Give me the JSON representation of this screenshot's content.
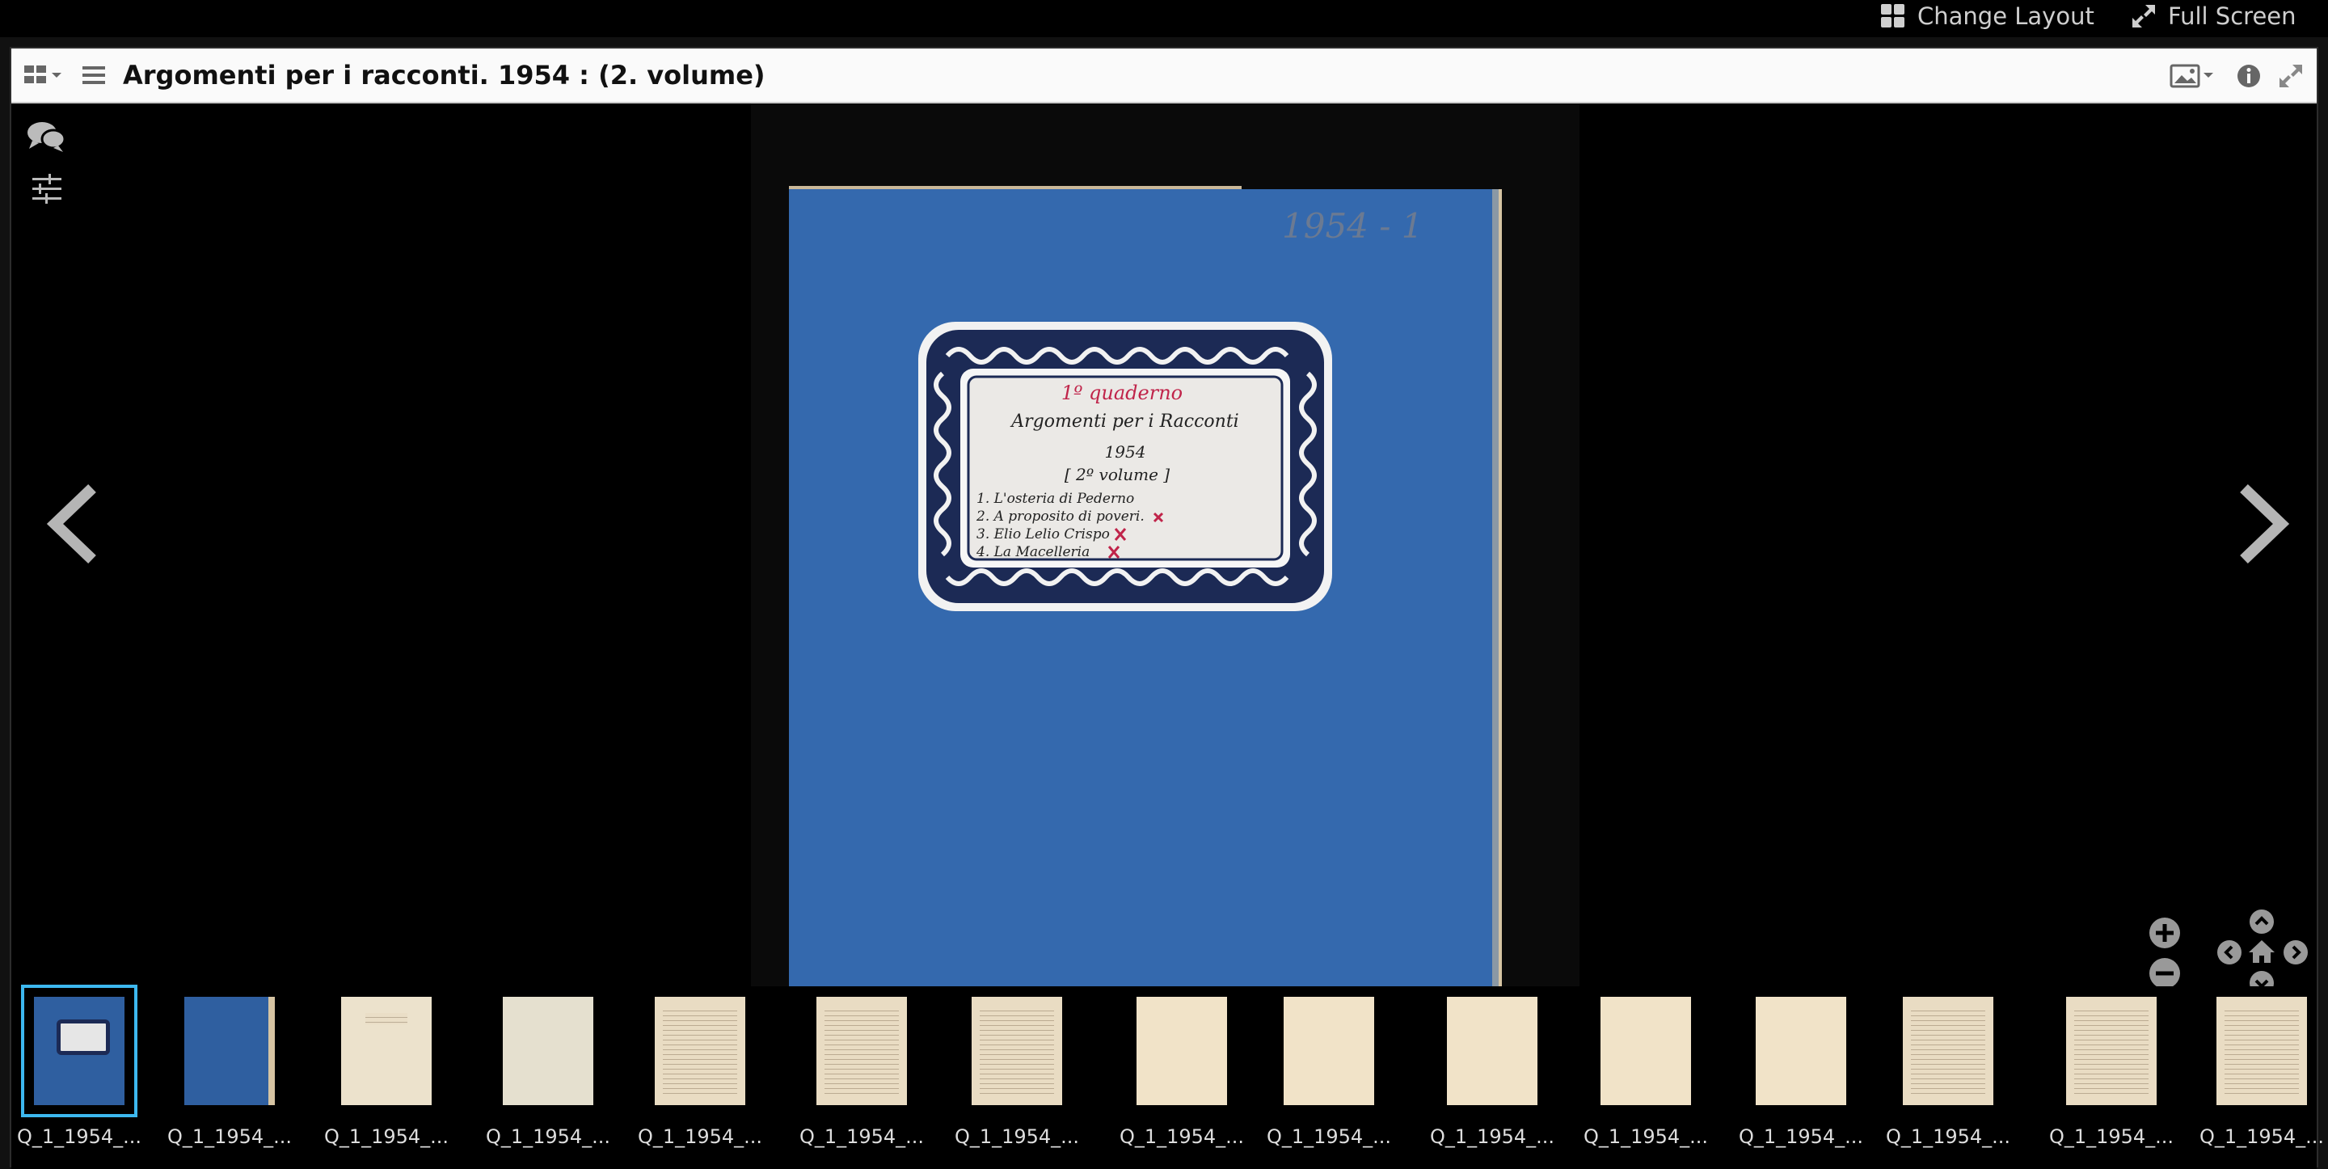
{
  "topbar": {
    "change_layout_label": "Change Layout",
    "full_screen_label": "Full Screen"
  },
  "window": {
    "title": "Argomenti per i racconti. 1954 : (2. volume)"
  },
  "document": {
    "corner_note": "1954 - 1",
    "label_lines": [
      "1º quaderno",
      "Argomenti per i Racconti",
      "1954",
      "[ 2º volume ]",
      "1. L'osteria di Pederno",
      "2. A proposito di poveri.",
      "3. Elio Lelio Crispo",
      "4. La Macelleria"
    ]
  },
  "thumbnails": [
    {
      "label": "Q_1_1954_...",
      "kind": "cover-label",
      "selected": true
    },
    {
      "label": "Q_1_1954_...",
      "kind": "cover-blue"
    },
    {
      "label": "Q_1_1954_...",
      "kind": "page-few"
    },
    {
      "label": "Q_1_1954_...",
      "kind": "page-blank"
    },
    {
      "label": "Q_1_1954_...",
      "kind": "page-text"
    },
    {
      "label": "Q_1_1954_...",
      "kind": "page-text"
    },
    {
      "label": "Q_1_1954_...",
      "kind": "page-text"
    },
    {
      "label": "Q_1_1954_...",
      "kind": "page-blank"
    },
    {
      "label": "Q_1_1954_...",
      "kind": "page-blank"
    },
    {
      "label": "Q_1_1954_...",
      "kind": "page-blank"
    },
    {
      "label": "Q_1_1954_...",
      "kind": "page-blank"
    },
    {
      "label": "Q_1_1954_...",
      "kind": "page-blank"
    },
    {
      "label": "Q_1_1954_...",
      "kind": "page-text"
    },
    {
      "label": "Q_1_1954_...",
      "kind": "page-text"
    },
    {
      "label": "Q_1_1954_...",
      "kind": "page-text"
    }
  ],
  "colors": {
    "accent_selected": "#3db8ef",
    "cover_blue": "#2f5fa0",
    "ink_red": "#c0244a"
  }
}
